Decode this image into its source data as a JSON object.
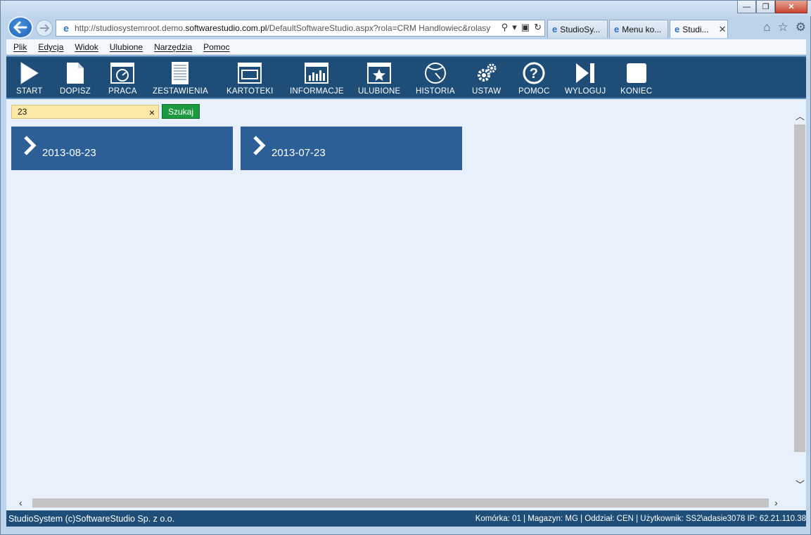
{
  "browser": {
    "url_prefix": "http://studiosystemroot.demo.",
    "url_host": "softwarestudio.com.pl",
    "url_suffix": "/DefaultSoftwareStudio.aspx?rola=CRM Handlowiec&rolasy",
    "tabs": [
      {
        "label": "StudioSy..."
      },
      {
        "label": "Menu ko..."
      },
      {
        "label": "Studi..."
      }
    ]
  },
  "menubar": {
    "items": [
      "Plik",
      "Edycja",
      "Widok",
      "Ulubione",
      "Narzędzia",
      "Pomoc"
    ]
  },
  "toolbar": {
    "items": [
      {
        "label": "START",
        "icon": "play-icon"
      },
      {
        "label": "DOPISZ",
        "icon": "document-icon"
      },
      {
        "label": "PRACA",
        "icon": "gauge-window-icon"
      },
      {
        "label": "ZESTAWIENIA",
        "icon": "report-icon"
      },
      {
        "label": "KARTOTEKI",
        "icon": "monitor-icon"
      },
      {
        "label": "INFORMACJE",
        "icon": "bar-chart-icon"
      },
      {
        "label": "ULUBIONE",
        "icon": "star-window-icon"
      },
      {
        "label": "HISTORIA",
        "icon": "history-icon"
      },
      {
        "label": "USTAW",
        "icon": "gears-icon"
      },
      {
        "label": "POMOC",
        "icon": "help-icon"
      },
      {
        "label": "WYLOGUJ",
        "icon": "skip-icon"
      },
      {
        "label": "KONIEC",
        "icon": "square-icon"
      }
    ]
  },
  "search": {
    "value": "23",
    "clear_label": "×",
    "button_label": "Szukaj"
  },
  "results": [
    {
      "label": "2013-08-23"
    },
    {
      "label": "2013-07-23"
    }
  ],
  "status": {
    "left": "StudioSystem (c)SoftwareStudio Sp. z o.o.",
    "right": "Komórka: 01 | Magazyn: MG | Oddział: CEN | Użytkownik: SS2\\adasie3078 IP: 62.21.110.38"
  },
  "colors": {
    "toolbar": "#1e4d78",
    "tile": "#2b5f96",
    "search_bg": "#fde9a6",
    "search_button": "#1c9a3f",
    "content_bg": "#e8f0fb"
  }
}
